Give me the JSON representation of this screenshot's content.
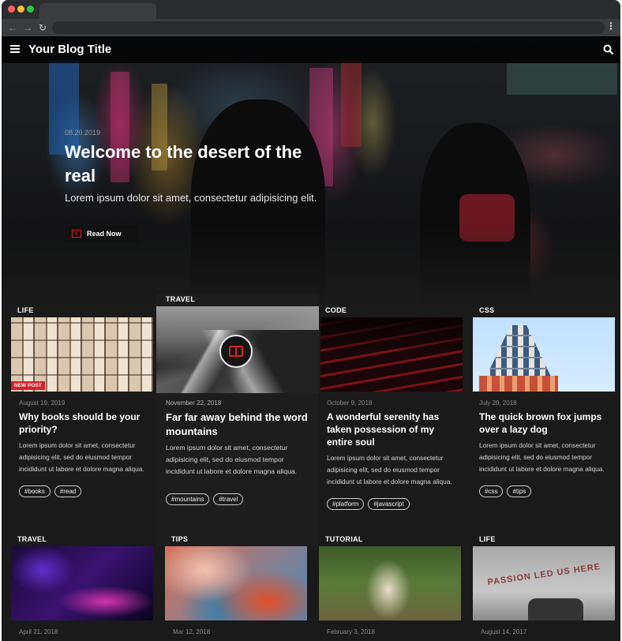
{
  "blog": {
    "title": "Your Blog Title"
  },
  "hero": {
    "date": "08.20.2019",
    "title": "Welcome to the desert of the real",
    "subtitle": "Lorem ipsum dolor sit amet, consectetur adipisicing elit.",
    "button_label": "Read Now"
  },
  "badges": {
    "new_post": "NEW POST"
  },
  "posts": [
    {
      "category": "LIFE",
      "date": "August 19, 2019",
      "title": "Why books should be your priority?",
      "excerpt": "Lorem ipsum dolor sit amet, consectetur adipisicing elit, sed do eiusmod tempor incididunt ut labore et dolore magna aliqua.",
      "tags": [
        "#books",
        "#read"
      ]
    },
    {
      "category": "TRAVEL",
      "date": "November 22, 2018",
      "title": "Far far away behind the word mountains",
      "excerpt": "Lorem ipsum dolor sit amet, consectetur adipisicing elit, sed do eiusmod tempor incididunt ut labore et dolore magna aliqua.",
      "tags": [
        "#mountains",
        "#travel"
      ]
    },
    {
      "category": "CODE",
      "date": "October 9, 2018",
      "title": "A wonderful serenity has taken possession of my entire soul",
      "excerpt": "Lorem ipsum dolor sit amet, consectetur adipisicing elit, sed do eiusmod tempor incididunt ut labore et dolore magna aliqua.",
      "tags": [
        "#platform",
        "#javascript"
      ]
    },
    {
      "category": "CSS",
      "date": "July 20, 2018",
      "title": "The quick brown fox jumps over a lazy dog",
      "excerpt": "Lorem ipsum dolor sit amet, consectetur adipisicing elit, sed do eiusmod tempor incididunt ut labore et dolore magna aliqua.",
      "tags": [
        "#css",
        "#tips"
      ]
    },
    {
      "category": "TRAVEL",
      "date": "April 21, 2018"
    },
    {
      "category": "TIPS",
      "date": "Mar 12, 2018"
    },
    {
      "category": "TUTORIAL",
      "date": "February 3, 2018"
    },
    {
      "category": "LIFE",
      "date": "August 14, 2017",
      "image_text": "PASSION LED US HERE"
    }
  ],
  "colors": {
    "accent": "#d8202a",
    "background": "#1a1a1a"
  }
}
